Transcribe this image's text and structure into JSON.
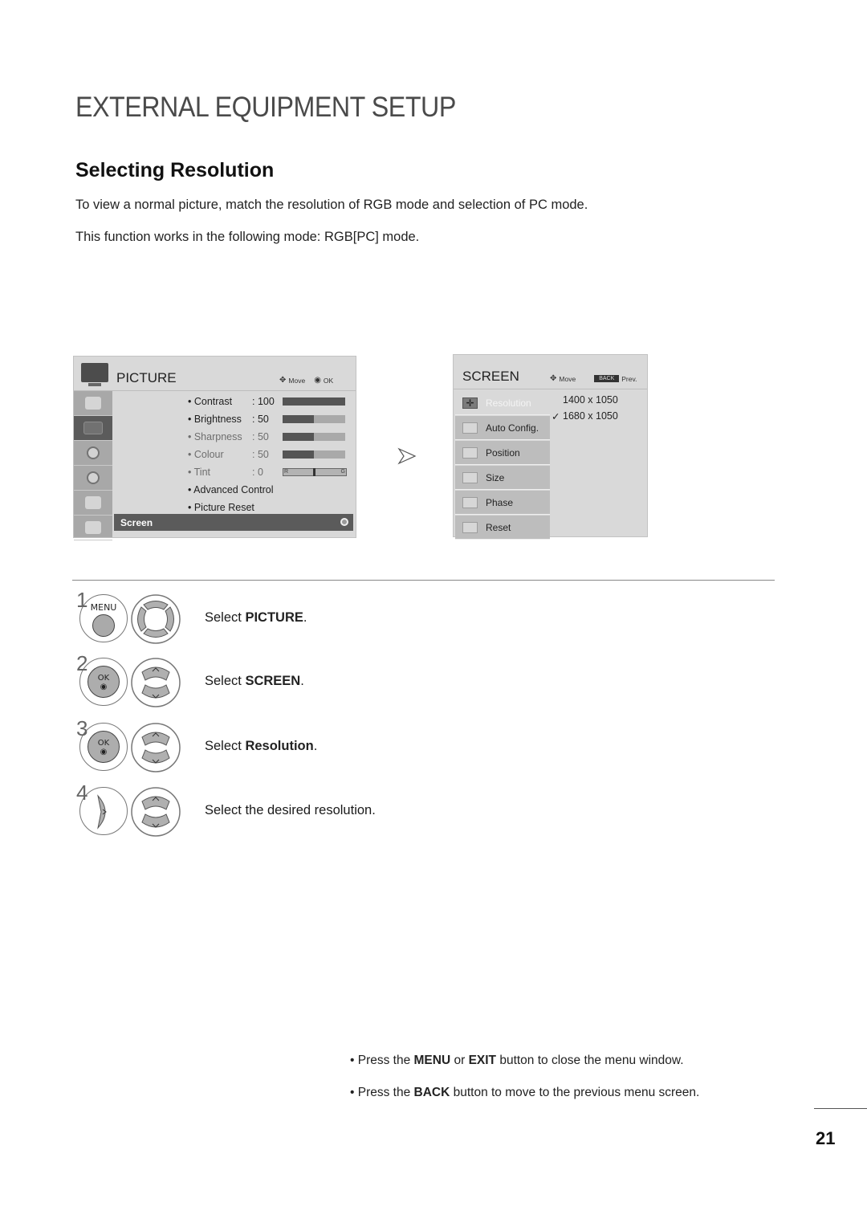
{
  "page": {
    "title": "EXTERNAL EQUIPMENT SETUP",
    "section_title": "Selecting Resolution",
    "intro": "To view a normal picture, match the resolution of RGB mode and selection of PC mode.",
    "mode_note": "This function works in the following mode: RGB[PC] mode.",
    "page_number": "21"
  },
  "picture_menu": {
    "title": "PICTURE",
    "hint_move": "Move",
    "hint_ok": "OK",
    "sidebar_icons": [
      "picture-wizard-icon",
      "tv-picture-icon",
      "audio-icon",
      "time-icon",
      "option-icon",
      "lock-icon"
    ],
    "active_sidebar_index": 1,
    "items": [
      {
        "label": "• Contrast",
        "value": ": 100",
        "level": 100,
        "dim": false
      },
      {
        "label": "• Brightness",
        "value": ": 50",
        "level": 50,
        "dim": false
      },
      {
        "label": "• Sharpness",
        "value": ": 50",
        "level": 50,
        "dim": true
      },
      {
        "label": "• Colour",
        "value": ": 50",
        "level": 50,
        "dim": true
      },
      {
        "label": "• Tint",
        "value": ": 0",
        "dim": true
      },
      {
        "label": "• Advanced Control",
        "dim": false
      },
      {
        "label": "• Picture Reset",
        "dim": false
      }
    ],
    "tint": {
      "left_label": "R",
      "right_label": "G",
      "value": 0
    },
    "highlighted": "Screen"
  },
  "screen_menu": {
    "title": "SCREEN",
    "hint_move": "Move",
    "hint_back": "BACK",
    "hint_prev": "Prev.",
    "items": [
      "Resolution",
      "Auto Config.",
      "Position",
      "Size",
      "Phase",
      "Reset"
    ],
    "selected": "Resolution",
    "resolution_options": [
      {
        "label": "1400 x 1050",
        "checked": false
      },
      {
        "label": "1680 x 1050",
        "checked": true
      }
    ],
    "check_glyph": "✓"
  },
  "steps": [
    {
      "num": "1",
      "button": "MENU",
      "prefix": "Select ",
      "bold": "PICTURE",
      "suffix": "."
    },
    {
      "num": "2",
      "button": "OK",
      "prefix": "Select ",
      "bold": "SCREEN",
      "suffix": "."
    },
    {
      "num": "3",
      "button": "OK",
      "prefix": "Select ",
      "bold": "Resolution",
      "suffix": "."
    },
    {
      "num": "4",
      "button": "RIGHT",
      "prefix": "Select the desired resolution.",
      "bold": "",
      "suffix": ""
    }
  ],
  "notes": [
    {
      "pre": "• Press the ",
      "b1": "MENU",
      "mid": " or ",
      "b2": "EXIT",
      "post": " button to close the menu window."
    },
    {
      "pre": "• Press the ",
      "b1": "BACK",
      "mid": "",
      "b2": "",
      "post": " button to move to the previous menu screen."
    }
  ]
}
